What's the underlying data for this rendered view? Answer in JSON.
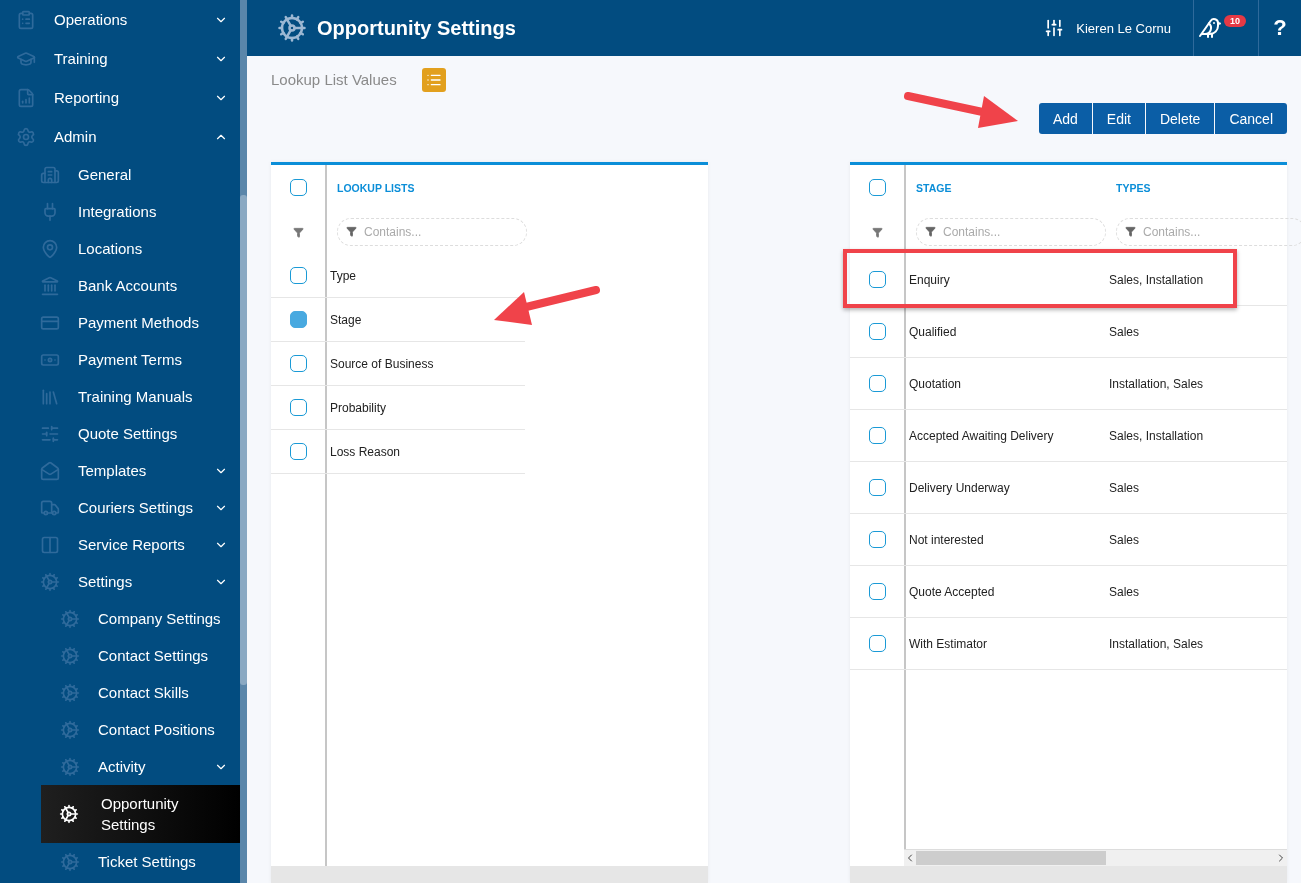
{
  "sidebar": {
    "items": [
      {
        "label": "Operations",
        "expanded": false,
        "selected": false
      },
      {
        "label": "Training",
        "expanded": false,
        "selected": false
      },
      {
        "label": "Reporting",
        "expanded": false,
        "selected": false
      },
      {
        "label": "Admin",
        "expanded": true,
        "selected": false,
        "children": [
          {
            "label": "General",
            "selected": false
          },
          {
            "label": "Integrations",
            "selected": false
          },
          {
            "label": "Locations",
            "selected": false
          },
          {
            "label": "Bank Accounts",
            "selected": false
          },
          {
            "label": "Payment Methods",
            "selected": false
          },
          {
            "label": "Payment Terms",
            "selected": false
          },
          {
            "label": "Training Manuals",
            "selected": false
          },
          {
            "label": "Quote Settings",
            "selected": false
          },
          {
            "label": "Templates",
            "expanded": false,
            "selected": false
          },
          {
            "label": "Couriers Settings",
            "expanded": false,
            "selected": false
          },
          {
            "label": "Service Reports",
            "expanded": false,
            "selected": false
          },
          {
            "label": "Settings",
            "expanded": false,
            "selected": false,
            "children": [
              {
                "label": "Company Settings",
                "selected": false
              },
              {
                "label": "Contact Settings",
                "selected": false
              },
              {
                "label": "Contact Skills",
                "selected": false
              },
              {
                "label": "Contact Positions",
                "selected": false
              },
              {
                "label": "Activity",
                "expanded": false,
                "selected": false
              },
              {
                "label": "Opportunity Settings",
                "selected": true
              },
              {
                "label": "Ticket Settings",
                "selected": false
              }
            ]
          }
        ]
      }
    ]
  },
  "header": {
    "title": "Opportunity Settings",
    "user": "Kieren Le Cornu",
    "badge": "10",
    "help": "?"
  },
  "toolbar": {
    "title": "Lookup List Values",
    "buttons": [
      "Add",
      "Edit",
      "Delete",
      "Cancel"
    ]
  },
  "lookup_table": {
    "all_selected": false,
    "columns": [
      "LOOKUP LISTS"
    ],
    "filter_placeholders": [
      "Contains..."
    ],
    "rows": [
      {
        "name": "Type",
        "selected": false
      },
      {
        "name": "Stage",
        "selected": true
      },
      {
        "name": "Source of Business",
        "selected": false
      },
      {
        "name": "Probability",
        "selected": false
      },
      {
        "name": "Loss Reason",
        "selected": false
      }
    ]
  },
  "values_table": {
    "all_selected": false,
    "columns": [
      "STAGE",
      "TYPES"
    ],
    "filter_placeholders": [
      "Contains...",
      "Contains..."
    ],
    "rows": [
      {
        "stage": "Enquiry",
        "types": "Sales, Installation",
        "selected": false,
        "highlighted": true
      },
      {
        "stage": "Qualified",
        "types": "Sales",
        "selected": false,
        "highlighted": false
      },
      {
        "stage": "Quotation",
        "types": "Installation, Sales",
        "selected": false,
        "highlighted": false
      },
      {
        "stage": "Accepted Awaiting Delivery",
        "types": "Sales, Installation",
        "selected": false,
        "highlighted": false
      },
      {
        "stage": "Delivery Underway",
        "types": "Sales",
        "selected": false,
        "highlighted": false
      },
      {
        "stage": "Not interested",
        "types": "Sales",
        "selected": false,
        "highlighted": false
      },
      {
        "stage": "Quote Accepted",
        "types": "Sales",
        "selected": false,
        "highlighted": false
      },
      {
        "stage": "With Estimator",
        "types": "Installation, Sales",
        "selected": false,
        "highlighted": false
      }
    ]
  }
}
